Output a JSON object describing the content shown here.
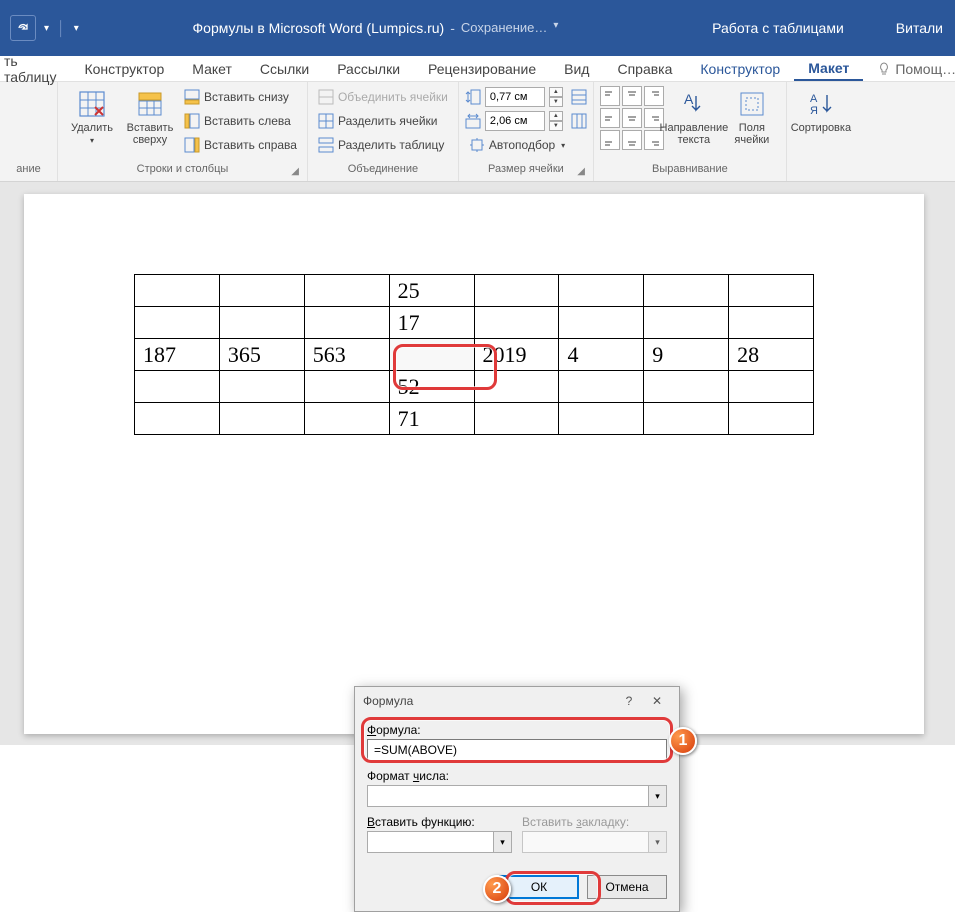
{
  "titlebar": {
    "doc_title": "Формулы в Microsoft Word (Lumpics.ru)",
    "saving": "Сохранение…",
    "context_tab": "Работа с таблицами",
    "user": "Витали"
  },
  "tabs": {
    "draw_table_partial": "ть таблицу",
    "constructor": "Конструктор",
    "layout": "Макет",
    "references": "Ссылки",
    "mailings": "Рассылки",
    "review": "Рецензирование",
    "view": "Вид",
    "help": "Справка",
    "tt_constructor": "Конструктор",
    "tt_layout": "Макет",
    "tell_me": "Помощ…"
  },
  "ribbon": {
    "group_labels": {
      "partial": "ание",
      "rows_cols": "Строки и столбцы",
      "merge": "Объединение",
      "cell_size": "Размер ячейки",
      "alignment": "Выравнивание"
    },
    "delete": "Удалить",
    "insert_above": "Вставить сверху",
    "insert_below": "Вставить снизу",
    "insert_left": "Вставить слева",
    "insert_right": "Вставить справа",
    "merge_cells": "Объединить ячейки",
    "split_cells": "Разделить ячейки",
    "split_table": "Разделить таблицу",
    "height": "0,77 см",
    "width": "2,06 см",
    "autofit": "Автоподбор",
    "text_direction": "Направление текста",
    "cell_margins": "Поля ячейки",
    "sort": "Сортировка"
  },
  "table": {
    "rows": [
      [
        "",
        "",
        "",
        "25",
        "",
        "",
        "",
        ""
      ],
      [
        "",
        "",
        "",
        "17",
        "",
        "",
        "",
        ""
      ],
      [
        "187",
        "365",
        "563",
        "",
        "2019",
        "4",
        "9",
        "28"
      ],
      [
        "",
        "",
        "",
        "52",
        "",
        "",
        "",
        ""
      ],
      [
        "",
        "",
        "",
        "71",
        "",
        "",
        "",
        ""
      ]
    ]
  },
  "dialog": {
    "title": "Формула",
    "formula_label": "Формула:",
    "formula_value": "=SUM(ABOVE)",
    "number_format_label": "Формат числа:",
    "paste_function_label": "Вставить функцию:",
    "paste_bookmark_label": "Вставить закладку:",
    "ok": "ОК",
    "cancel": "Отмена"
  },
  "badges": {
    "one": "1",
    "two": "2"
  }
}
